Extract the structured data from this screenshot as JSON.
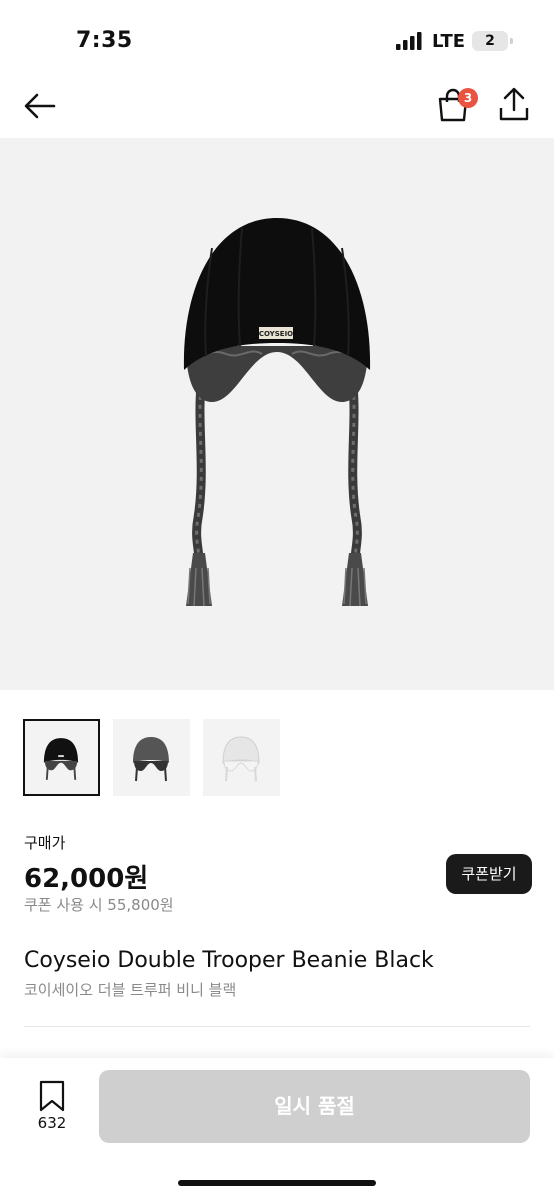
{
  "status_bar": {
    "time": "7:35",
    "network": "LTE",
    "battery": "2"
  },
  "nav": {
    "back_icon": "arrow-left-icon",
    "bag_icon": "shopping-bag-icon",
    "bag_count": "3",
    "share_icon": "share-upload-icon"
  },
  "colors": {
    "badge": "#e9533f",
    "dark_button": "#1a1a1a",
    "disabled_button": "#cfcfcf",
    "muted_text": "#8a8a8a",
    "image_bg": "#f2f2f2"
  },
  "gallery": {
    "thumbnails": [
      {
        "variant": "black",
        "selected": true
      },
      {
        "variant": "gray",
        "selected": false
      },
      {
        "variant": "white",
        "selected": false
      }
    ]
  },
  "price": {
    "label": "구매가",
    "amount": "62,000원",
    "coupon_text": "쿠폰 사용 시 55,800원",
    "coupon_button": "쿠폰받기"
  },
  "product": {
    "title": "Coyseio Double Trooper Beanie Black",
    "subtitle": "코이세이오 더블 트루퍼 비니 블랙",
    "brand_label": "COYSEIO"
  },
  "bottom": {
    "wishlist_icon": "bookmark-icon",
    "wishlist_count": "632",
    "action_label": "일시 품절"
  }
}
